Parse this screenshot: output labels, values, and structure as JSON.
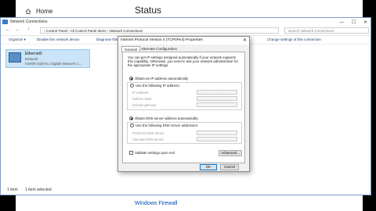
{
  "settings": {
    "home_label": "Home",
    "page_title": "Status",
    "bottom_link": "Windows Firewall"
  },
  "net_window": {
    "title": "Network Connections",
    "nav": {
      "back": "←",
      "forward": "→",
      "up": "↑"
    },
    "address_path": "›  Control Panel  ›  All Control Panel Items  ›  Network Connections",
    "search_placeholder": "Search Network Connections",
    "window_buttons": {
      "minimize": "—",
      "maximize": "☐",
      "close": "✕"
    },
    "commands": [
      "Organize ▾",
      "Disable this network device",
      "Diagnose this",
      "Change settings of this connection"
    ],
    "adapter": {
      "name": "Ethernet0",
      "status": "Network",
      "device": "Intel(R) 82574L Gigabit Network C..."
    },
    "status_bar": {
      "items": "1 item",
      "selected": "1 item selected"
    }
  },
  "dialog": {
    "title": "Internet Protocol Version 4 (TCP/IPv4) Properties",
    "close": "✕",
    "tabs": [
      "General",
      "Alternate Configuration"
    ],
    "intro": "You can get IP settings assigned automatically if your network supports this capability. Otherwise, you need to ask your network administrator for the appropriate IP settings.",
    "ip_auto": "Obtain an IP address automatically",
    "ip_manual": "Use the following IP address:",
    "ip_fields": [
      {
        "label": "IP address:",
        "value": ". . ."
      },
      {
        "label": "Subnet mask:",
        "value": ". . ."
      },
      {
        "label": "Default gateway:",
        "value": ". . ."
      }
    ],
    "dns_auto": "Obtain DNS server address automatically",
    "dns_manual": "Use the following DNS server addresses:",
    "dns_fields": [
      {
        "label": "Preferred DNS server:",
        "value": ". . ."
      },
      {
        "label": "Alternate DNS server:",
        "value": ". . ."
      }
    ],
    "validate": "Validate settings upon exit",
    "advanced": "Advanced...",
    "ok": "OK",
    "cancel": "Cancel"
  }
}
